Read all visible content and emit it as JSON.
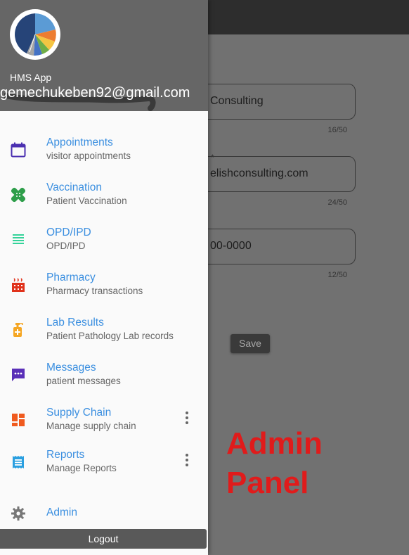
{
  "header": {
    "app_name": "HMS App",
    "email": "gemechukeben92@gmail.com"
  },
  "menu": [
    {
      "title": "Appointments",
      "subtitle": "visitor appointments",
      "icon": "calendar-icon",
      "color": "#4a2fb0"
    },
    {
      "title": "Vaccination",
      "subtitle": "Patient Vaccination",
      "icon": "bandage-icon",
      "color": "#2e9e4a"
    },
    {
      "title": "OPD/IPD",
      "subtitle": "OPD/IPD",
      "icon": "list-lines-icon",
      "color": "#35d39a"
    },
    {
      "title": "Pharmacy",
      "subtitle": "Pharmacy transactions",
      "icon": "pharmacy-icon",
      "color": "#e0321b"
    },
    {
      "title": "Lab Results",
      "subtitle": "Patient Pathology Lab records",
      "icon": "sanitizer-icon",
      "color": "#f5a623"
    },
    {
      "title": "Messages",
      "subtitle": "patient messages",
      "icon": "message-icon",
      "color": "#5a2fb8"
    },
    {
      "title": "Supply Chain",
      "subtitle": "Manage supply chain",
      "icon": "dashboard-icon",
      "color": "#f05a1e"
    },
    {
      "title": "Reports",
      "subtitle": "Manage Reports",
      "icon": "receipt-icon",
      "color": "#2a9fe0"
    },
    {
      "title": "Admin",
      "subtitle": "",
      "icon": "gear-icon",
      "color": "#777777"
    }
  ],
  "logout_label": "Logout",
  "background": {
    "fields": [
      {
        "value": "Consulting",
        "counter": "16/50"
      },
      {
        "value": "elishconsulting.com",
        "counter": "24/50"
      },
      {
        "value": "00-0000",
        "counter": "12/50"
      }
    ],
    "required_mark": "*",
    "save_label": "Save",
    "admin_panel_line1": "Admin",
    "admin_panel_line2": "Panel"
  }
}
